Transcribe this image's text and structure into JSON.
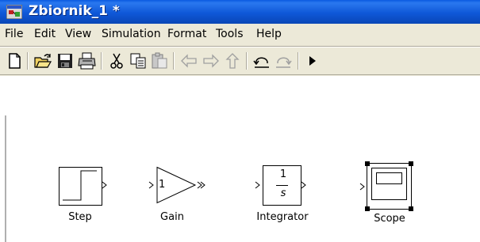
{
  "window": {
    "title": "Zbiornik_1 *"
  },
  "menu": {
    "items": [
      "File",
      "Edit",
      "View",
      "Simulation",
      "Format",
      "Tools",
      "Help"
    ]
  },
  "toolbar": {
    "buttons": [
      "new-icon",
      "open-icon",
      "save-icon",
      "print-icon",
      "cut-icon",
      "copy-icon",
      "paste-icon",
      "back-icon",
      "forward-icon",
      "up-icon",
      "undo-icon",
      "redo-icon",
      "play-icon"
    ]
  },
  "blocks": [
    {
      "label": "Step"
    },
    {
      "label": "Gain",
      "value": "1"
    },
    {
      "label": "Integrator",
      "numerator": "1",
      "denominator": "s"
    },
    {
      "label": "Scope"
    }
  ],
  "colors": {
    "titlebar": "#0b52d0",
    "menubar": "#ece9d8"
  }
}
